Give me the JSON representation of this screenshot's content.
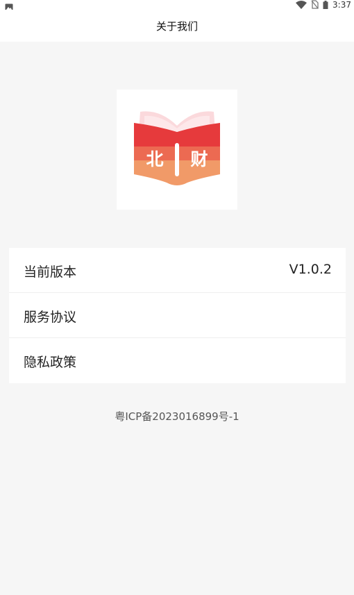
{
  "status_bar": {
    "time": "3:37",
    "icons": [
      "image-icon",
      "wifi-icon",
      "no-sim-icon",
      "battery-icon"
    ]
  },
  "header": {
    "title": "关于我们"
  },
  "logo": {
    "char_left": "北",
    "char_right": "财",
    "colors": {
      "top": "#e63a3c",
      "middle": "#ec6a52",
      "bottom": "#f19a68",
      "pages": "#fbd9dc"
    }
  },
  "menu": {
    "version_label": "当前版本",
    "version_value": "V1.0.2",
    "service_label": "服务协议",
    "privacy_label": "隐私政策"
  },
  "footer": {
    "icp": "粤ICP备2023016899号-1"
  }
}
